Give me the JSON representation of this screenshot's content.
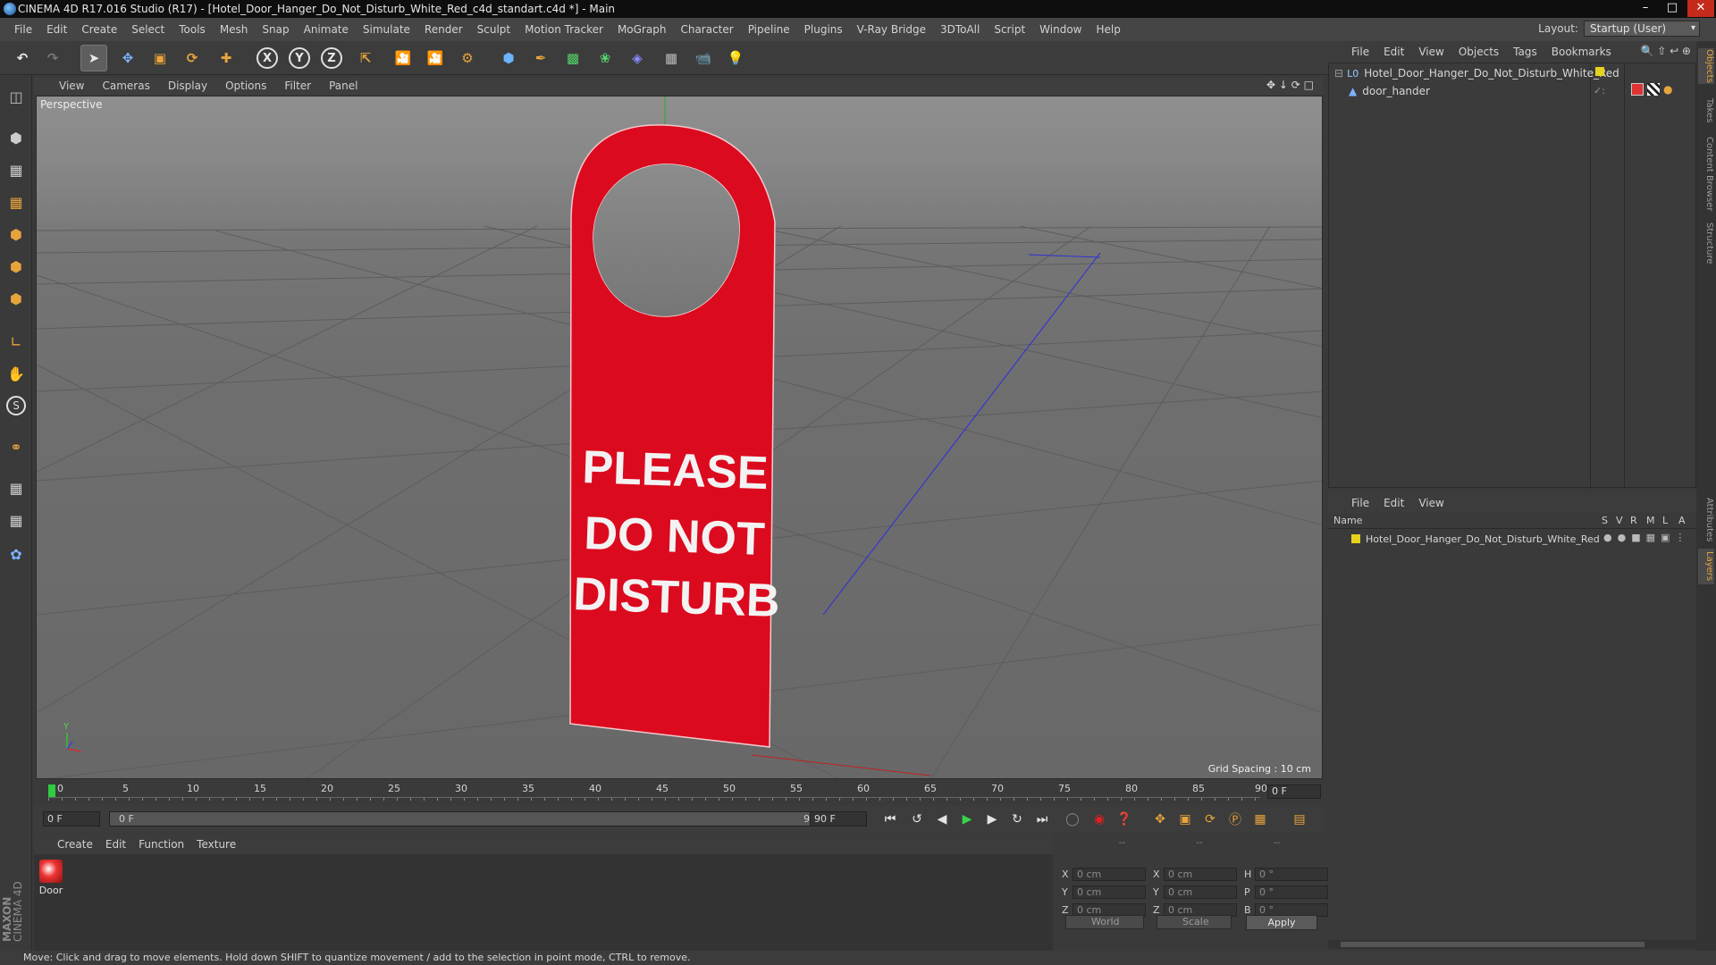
{
  "window": {
    "title": "CINEMA 4D R17.016 Studio (R17) - [Hotel_Door_Hanger_Do_Not_Disturb_White_Red_c4d_standart.c4d *] - Main"
  },
  "menubar": {
    "items": [
      "File",
      "Edit",
      "Create",
      "Select",
      "Tools",
      "Mesh",
      "Snap",
      "Animate",
      "Simulate",
      "Render",
      "Sculpt",
      "Motion Tracker",
      "MoGraph",
      "Character",
      "Pipeline",
      "Plugins",
      "V-Ray Bridge",
      "3DToAll",
      "Script",
      "Window",
      "Help"
    ],
    "layout_label": "Layout:",
    "layout_value": "Startup (User)"
  },
  "toolbar": {
    "axis_x": "X",
    "axis_y": "Y",
    "axis_z": "Z"
  },
  "viewport": {
    "menu": [
      "View",
      "Cameras",
      "Display",
      "Options",
      "Filter",
      "Panel"
    ],
    "camera_label": "Perspective",
    "grid_spacing": "Grid Spacing : 10 cm",
    "hanger_text": [
      "PLEASE",
      "DO NOT",
      "DISTURB"
    ],
    "axis_y": "Y"
  },
  "timeline": {
    "ticks": [
      "0",
      "5",
      "10",
      "15",
      "20",
      "25",
      "30",
      "35",
      "40",
      "45",
      "50",
      "55",
      "60",
      "65",
      "70",
      "75",
      "80",
      "85",
      "90"
    ],
    "current_frame": "0 F"
  },
  "transport": {
    "start_field": "0 F",
    "range_start": "0 F",
    "range_end": "90 F",
    "end_field": "90 F"
  },
  "material": {
    "menu": [
      "Create",
      "Edit",
      "Function",
      "Texture"
    ],
    "items": [
      {
        "name": "Door"
      }
    ]
  },
  "coordinates": {
    "header": [
      "--",
      "--",
      "--"
    ],
    "rows": [
      {
        "a": "X",
        "av": "0 cm",
        "b": "X",
        "bv": "0 cm",
        "c": "H",
        "cv": "0 °"
      },
      {
        "a": "Y",
        "av": "0 cm",
        "b": "Y",
        "bv": "0 cm",
        "c": "P",
        "cv": "0 °"
      },
      {
        "a": "Z",
        "av": "0 cm",
        "b": "Z",
        "bv": "0 cm",
        "c": "B",
        "cv": "0 °"
      }
    ],
    "mode": "World",
    "scale": "Scale",
    "apply": "Apply"
  },
  "objects": {
    "menu": [
      "File",
      "Edit",
      "View",
      "Objects",
      "Tags",
      "Bookmarks"
    ],
    "items": [
      {
        "name": "Hotel_Door_Hanger_Do_Not_Disturb_White_Red"
      },
      {
        "name": "door_hander"
      }
    ]
  },
  "layers": {
    "menu": [
      "File",
      "Edit",
      "View"
    ],
    "header_name": "Name",
    "header_cols": [
      "S",
      "V",
      "R",
      "M",
      "L",
      "A"
    ],
    "items": [
      {
        "name": "Hotel_Door_Hanger_Do_Not_Disturb_White_Red"
      }
    ]
  },
  "side_tabs": [
    "Objects",
    "Takes",
    "Content Browser",
    "Structure",
    "Attributes",
    "Layers"
  ],
  "status": "Move: Click and drag to move elements. Hold down SHIFT to quantize movement / add to the selection in point mode, CTRL to remove.",
  "brand": [
    "MAXON",
    "CINEMA 4D"
  ],
  "colors": {
    "accent": "#e7a33c",
    "hanger_red": "#dc0a1e",
    "layer_yellow": "#e6d21e"
  }
}
